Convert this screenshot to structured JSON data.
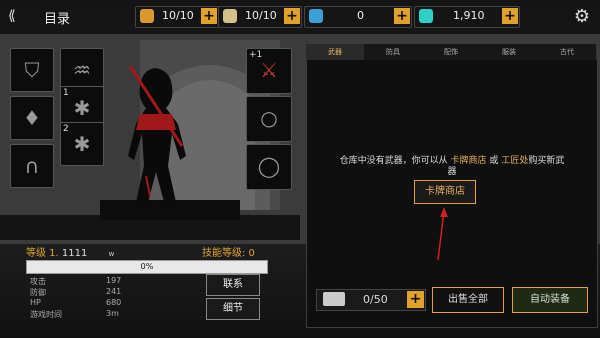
{
  "header": {
    "title": "目录",
    "resources": [
      {
        "value": "10/10",
        "icon": "potion-icon",
        "color": "#d89a2e"
      },
      {
        "value": "10/10",
        "icon": "dice-icon",
        "color": "#d4c08a"
      },
      {
        "value": "0",
        "icon": "blue-gem-icon",
        "color": "#3aa0d8"
      },
      {
        "value": "1,910",
        "icon": "cyan-crystal-icon",
        "color": "#2fd0c8"
      }
    ]
  },
  "armor_slots": {
    "helmet_badge": "1",
    "left_badge": "2",
    "weapon_badge": "+1"
  },
  "inventory": {
    "tabs": [
      "武器",
      "防具",
      "配饰",
      "服装",
      "古代"
    ],
    "active_tab": 0,
    "empty_message_pre": "仓库中没有武器，你可以从",
    "card_shop_link": "卡牌商店",
    "or_text": "或",
    "workshop_link": "工匠处",
    "empty_message_post": "购买新武",
    "empty_message_wrap": "器",
    "card_shop_button": "卡牌商店",
    "bag_count": "0/50",
    "sell_all_button": "出售全部",
    "auto_equip_button": "自动装备"
  },
  "character": {
    "level_label": "等级 1.",
    "level_value": "1111",
    "w_mark": "w",
    "skill_level": "技能等级: 0",
    "xp_percent": "0%",
    "stats": [
      {
        "label": "攻击",
        "value": "197"
      },
      {
        "label": "防御",
        "value": "241"
      },
      {
        "label": "HP",
        "value": "680"
      },
      {
        "label": "游戏时间",
        "value": "3m"
      }
    ],
    "contact_button": "联系",
    "detail_button": "细节"
  }
}
